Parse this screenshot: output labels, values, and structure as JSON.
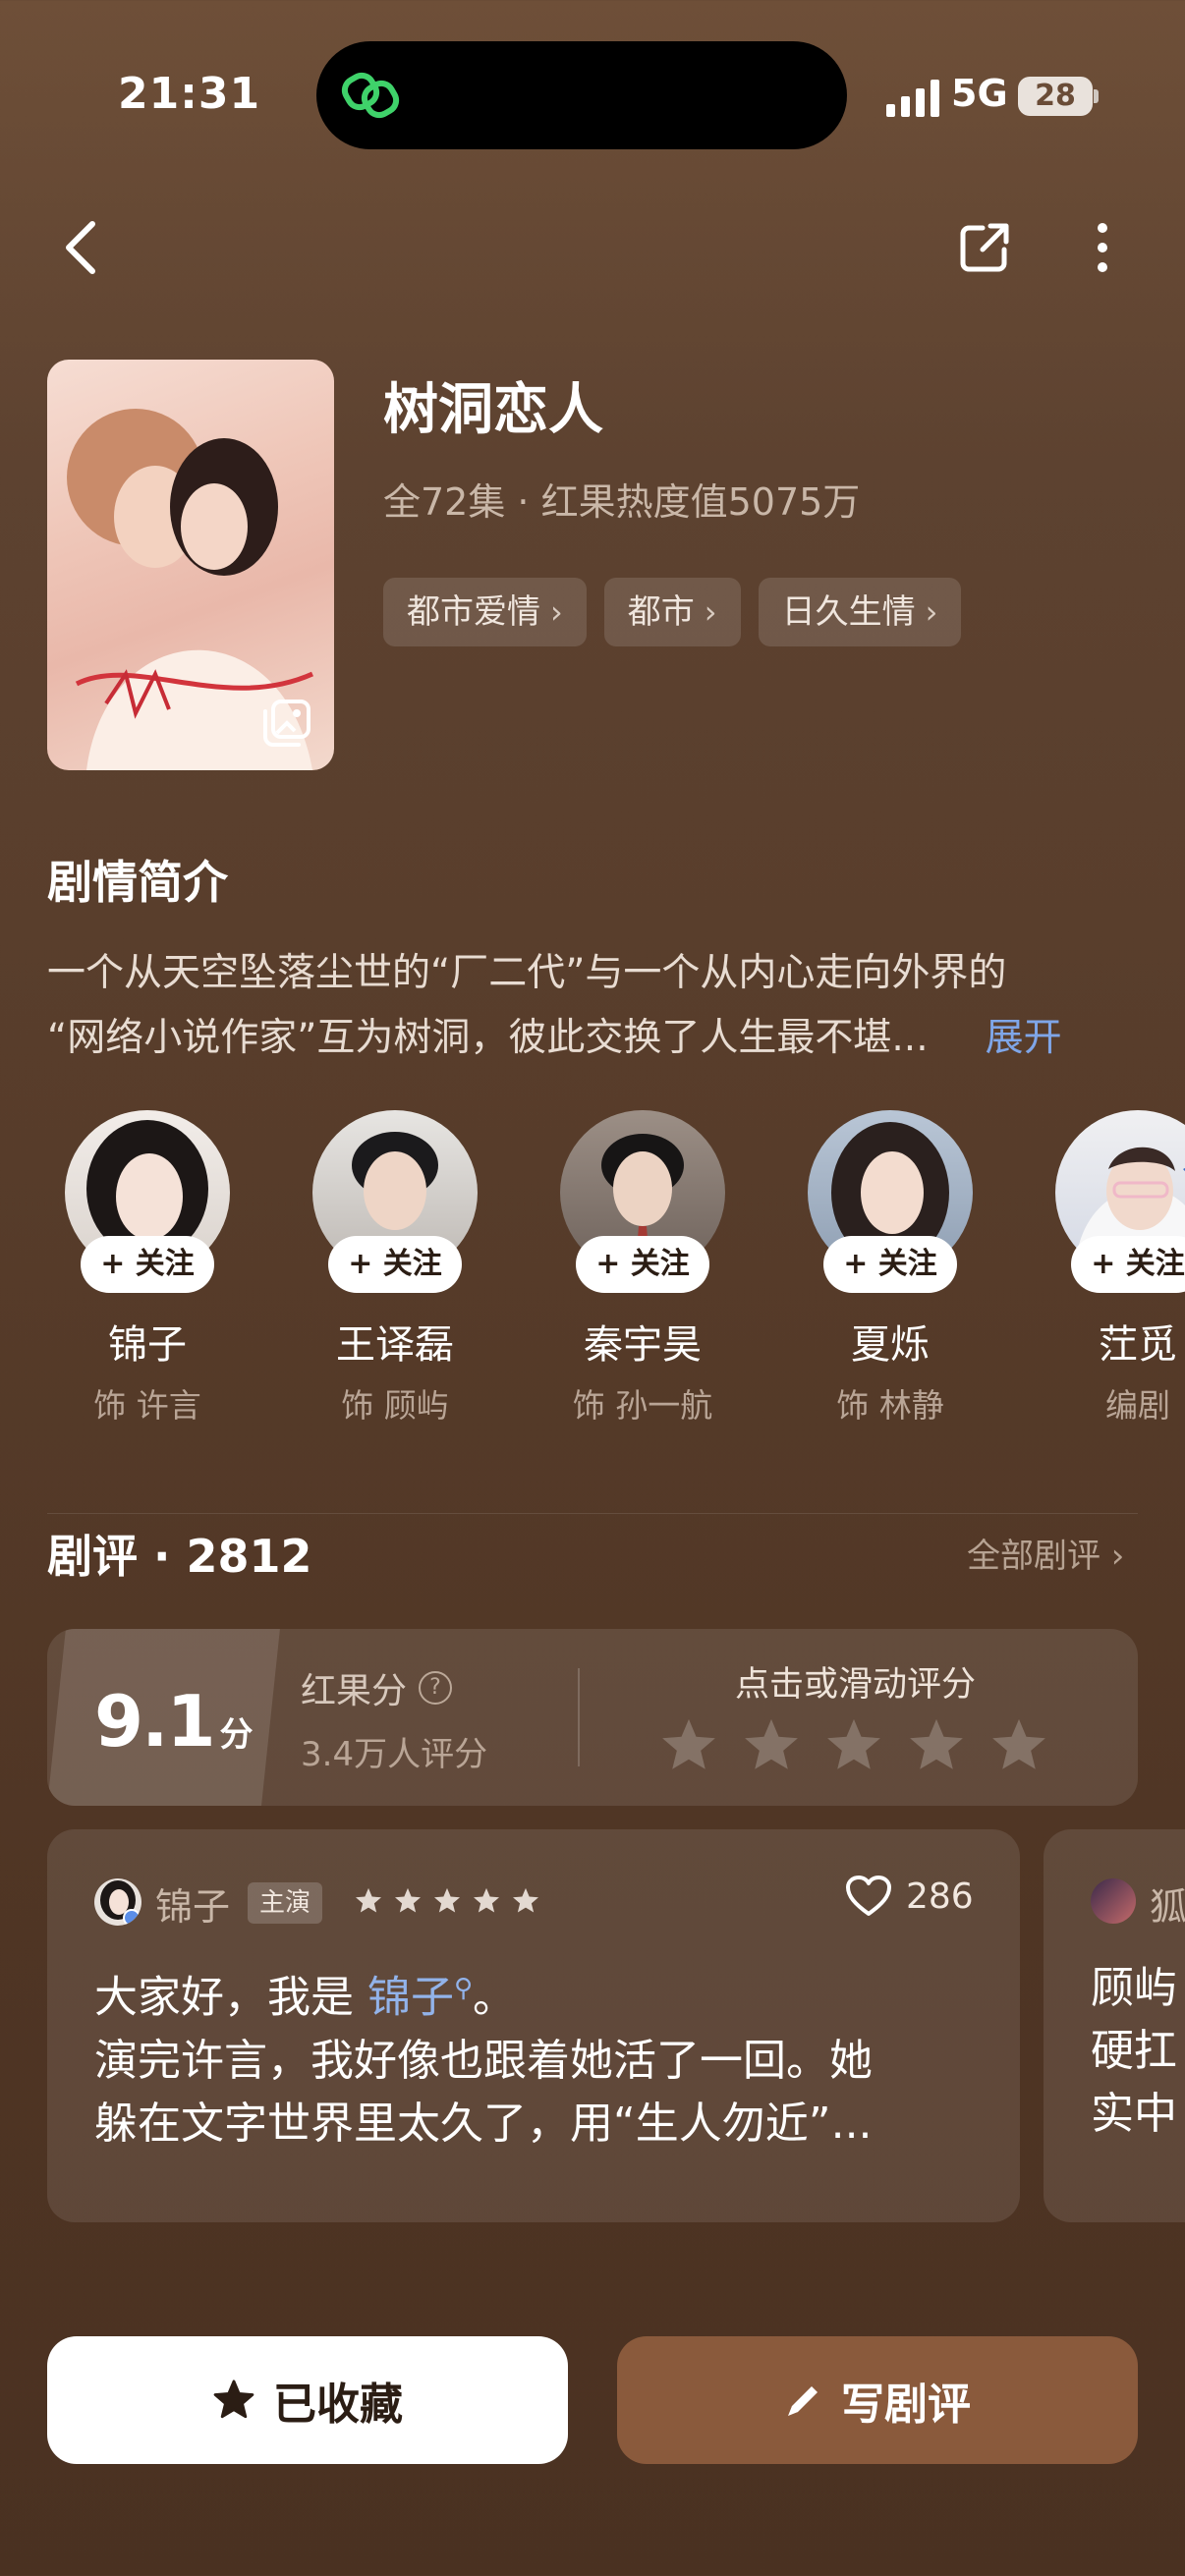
{
  "status_bar": {
    "time": "21:31",
    "network": "5G",
    "battery": "28"
  },
  "drama": {
    "title": "树洞恋人",
    "meta": "全72集 · 红果热度值5075万",
    "tags": [
      {
        "label": "都市爱情"
      },
      {
        "label": "都市"
      },
      {
        "label": "日久生情"
      }
    ]
  },
  "synopsis": {
    "title": "剧情简介",
    "line1": "一个从天空坠落尘世的“厂二代”与一个从内心走向外界的",
    "line2": "“网络小说作家”互为树洞，彼此交换了人生最不堪...",
    "expand": "展开"
  },
  "cast": [
    {
      "name": "锦子",
      "role": "饰 许言",
      "follow": "+ 关注"
    },
    {
      "name": "王译磊",
      "role": "饰 顾屿",
      "follow": "+ 关注"
    },
    {
      "name": "秦宇昊",
      "role": "饰 孙一航",
      "follow": "+ 关注"
    },
    {
      "name": "夏烁",
      "role": "饰 林静",
      "follow": "+ 关注"
    },
    {
      "name": "茳觅",
      "role": "编剧",
      "follow": "+ 关注"
    }
  ],
  "reviews": {
    "title": "剧评 · 2812",
    "all_label": "全部剧评 ›",
    "score": "9.1",
    "score_unit": "分",
    "score_label": "红果分",
    "score_count": "3.4万人评分",
    "rate_hint": "点击或滑动评分",
    "rate_stars": 5,
    "items": [
      {
        "user": "锦子",
        "badge": "主演",
        "stars": 5,
        "likes": "286",
        "text_prefix": "大家好，我是 ",
        "mention": "锦子",
        "text_suffix": "。",
        "line2": "演完许言，我好像也跟着她活了一回。她",
        "line3": "躲在文字世界里太久了，用“生人勿近”..."
      },
      {
        "user": "狐",
        "line1": "顾屿",
        "line2": "硬扛",
        "line3": "实中"
      }
    ]
  },
  "actions": {
    "favorite": "已收藏",
    "write_review": "写剧评"
  },
  "colors": {
    "accent_blue": "#7fa6e8",
    "write_button": "#8a5a3c",
    "background": "#573c2a"
  }
}
